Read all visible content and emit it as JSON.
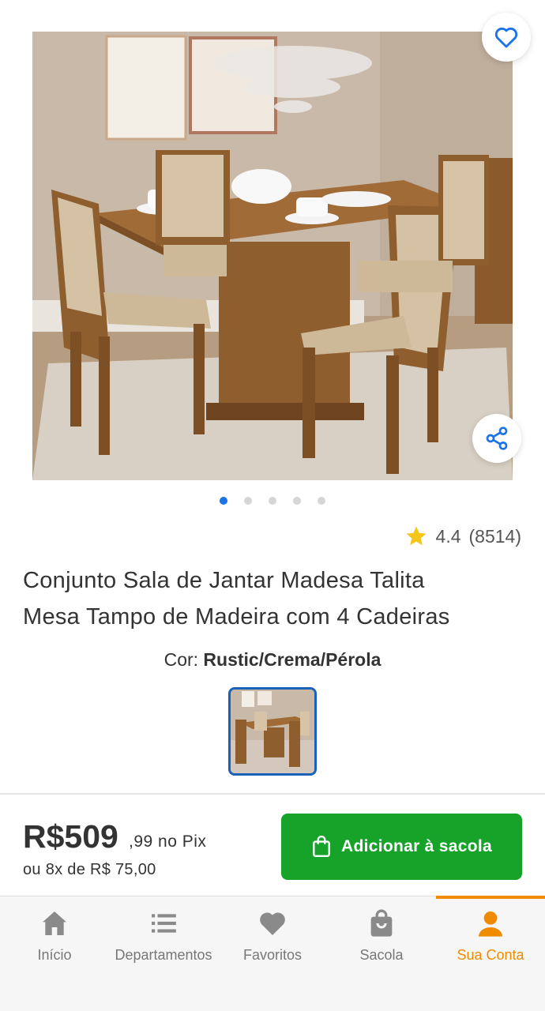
{
  "product": {
    "title_line1": "Conjunto Sala de Jantar Madesa Talita",
    "title_line2": "Mesa Tampo de Madeira com 4 Cadeiras",
    "rating": "4.4",
    "reviews": "(8514)",
    "color_label": "Cor:",
    "color_value": "Rustic/Crema/Pérola",
    "image_count": 5,
    "active_image": 1
  },
  "price": {
    "main": "R$509",
    "cents_pix": ",99 no Pix",
    "installments": "ou 8x de R$ 75,00"
  },
  "actions": {
    "add_to_bag": "Adicionar à sacola"
  },
  "nav": {
    "items": [
      {
        "label": "Início",
        "icon": "home-icon"
      },
      {
        "label": "Departamentos",
        "icon": "list-icon"
      },
      {
        "label": "Favoritos",
        "icon": "heart-icon"
      },
      {
        "label": "Sacola",
        "icon": "bag-icon"
      },
      {
        "label": "Sua Conta",
        "icon": "user-icon"
      }
    ],
    "active_index": 4
  },
  "colors": {
    "accent_blue": "#1a73e8",
    "buy_green": "#17a22a",
    "nav_active": "#f08a00",
    "star": "#f5c518"
  }
}
